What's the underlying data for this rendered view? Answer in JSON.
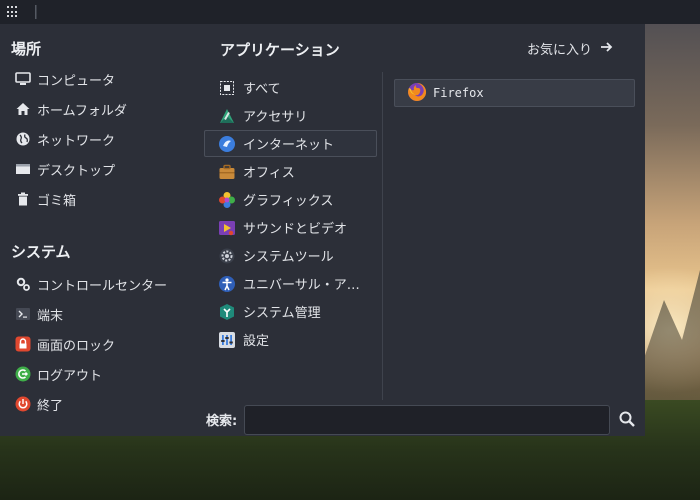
{
  "places": {
    "title": "場所",
    "items": [
      {
        "label": "コンピュータ",
        "icon": "computer-icon"
      },
      {
        "label": "ホームフォルダ",
        "icon": "home-icon"
      },
      {
        "label": "ネットワーク",
        "icon": "network-icon"
      },
      {
        "label": "デスクトップ",
        "icon": "desktop-icon"
      },
      {
        "label": "ゴミ箱",
        "icon": "trash-icon"
      }
    ]
  },
  "system": {
    "title": "システム",
    "items": [
      {
        "label": "コントロールセンター",
        "icon": "control-center-icon"
      },
      {
        "label": "端末",
        "icon": "terminal-icon"
      },
      {
        "label": "画面のロック",
        "icon": "lock-icon"
      },
      {
        "label": "ログアウト",
        "icon": "logout-icon"
      },
      {
        "label": "終了",
        "icon": "power-icon"
      }
    ]
  },
  "applications": {
    "title": "アプリケーション",
    "favorites_label": "お気に入り",
    "categories": [
      {
        "label": "すべて",
        "icon": "all-apps-icon"
      },
      {
        "label": "アクセサリ",
        "icon": "accessories-icon"
      },
      {
        "label": "インターネット",
        "icon": "internet-icon",
        "active": true
      },
      {
        "label": "オフィス",
        "icon": "office-icon"
      },
      {
        "label": "グラフィックス",
        "icon": "graphics-icon"
      },
      {
        "label": "サウンドとビデオ",
        "icon": "multimedia-icon"
      },
      {
        "label": "システムツール",
        "icon": "system-tools-icon"
      },
      {
        "label": "ユニバーサル・ア…",
        "icon": "accessibility-icon"
      },
      {
        "label": "システム管理",
        "icon": "administration-icon"
      },
      {
        "label": "設定",
        "icon": "settings-icon"
      }
    ],
    "apps": [
      {
        "label": "Firefox",
        "icon": "firefox-icon"
      }
    ]
  },
  "search": {
    "label": "検索:",
    "value": "",
    "placeholder": ""
  },
  "colors": {
    "menu_bg": "#2c2f38",
    "panel_bg": "#1f2229",
    "accent_red": "#e0482f",
    "accent_green": "#3fae49"
  }
}
